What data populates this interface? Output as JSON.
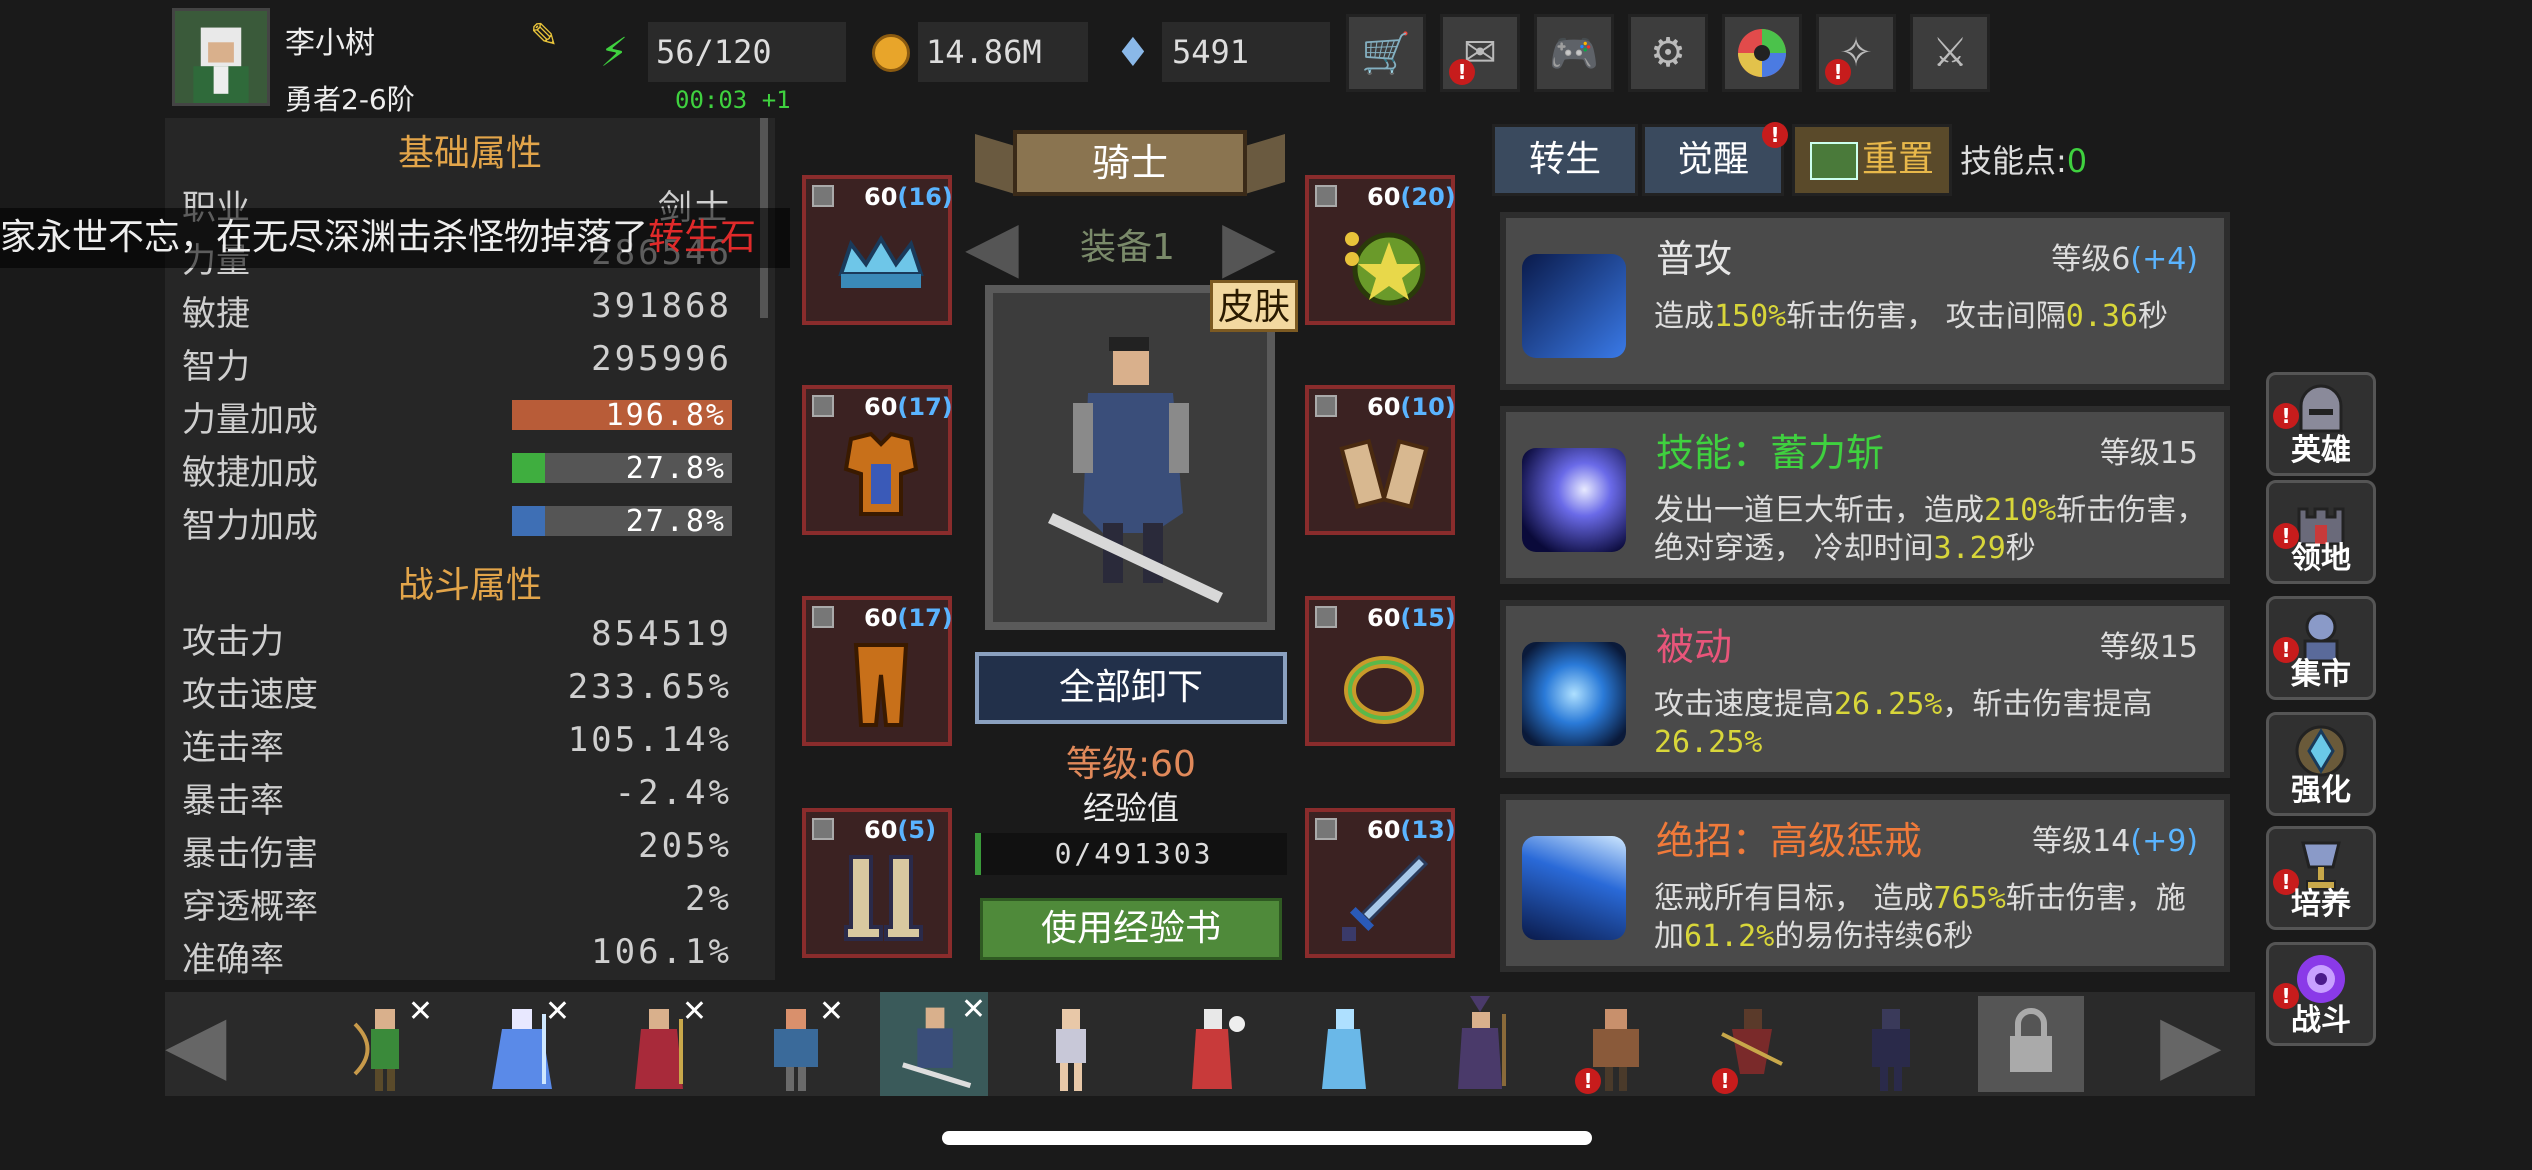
{
  "player": {
    "name": "李小树",
    "rank": "勇者2-6阶",
    "timer": "00:03 +1"
  },
  "resources": {
    "stamina": "56/120",
    "gold": "14.86M",
    "gems": "5491"
  },
  "top_buttons": [
    "cart-icon",
    "mail-icon",
    "gamepad-icon",
    "gear-icon",
    "aperture-icon",
    "crystal-icon",
    "crossed-swords-icon"
  ],
  "basic_attrs": {
    "title": "基础属性",
    "rows": [
      {
        "label": "职业",
        "value": "剑士"
      },
      {
        "label": "力量",
        "value": "286546"
      },
      {
        "label": "敏捷",
        "value": "391868"
      },
      {
        "label": "智力",
        "value": "295996"
      }
    ],
    "bonuses": [
      {
        "label": "力量加成",
        "value": "196.8%",
        "color": "#b85c38",
        "fill": 1.0
      },
      {
        "label": "敏捷加成",
        "value": "27.8%",
        "color": "#3fae3f",
        "fill": 0.15
      },
      {
        "label": "智力加成",
        "value": "27.8%",
        "color": "#3e6fb5",
        "fill": 0.15
      }
    ]
  },
  "combat_attrs": {
    "title": "战斗属性",
    "rows": [
      {
        "label": "攻击力",
        "value": "854519"
      },
      {
        "label": "攻击速度",
        "value": "233.65%"
      },
      {
        "label": "连击率",
        "value": "105.14%"
      },
      {
        "label": "暴击率",
        "value": "-2.4%"
      },
      {
        "label": "暴击伤害",
        "value": "205%"
      },
      {
        "label": "穿透概率",
        "value": "2%"
      },
      {
        "label": "准确率",
        "value": "106.1%"
      }
    ]
  },
  "ticker": {
    "text": "家永世不忘，在无尽深渊击杀怪物掉落了",
    "item": "转生石"
  },
  "equipment": {
    "class_name": "骑士",
    "set_label": "装备1",
    "skin_label": "皮肤",
    "unequip_all": "全部卸下",
    "level": "等级:60",
    "exp_label": "经验值",
    "exp_value": "0/491303",
    "use_book": "使用经验书",
    "slots": [
      {
        "lvl": "60",
        "plus": "(16)"
      },
      {
        "lvl": "60",
        "plus": "(20)"
      },
      {
        "lvl": "60",
        "plus": "(17)"
      },
      {
        "lvl": "60",
        "plus": "(10)"
      },
      {
        "lvl": "60",
        "plus": "(17)"
      },
      {
        "lvl": "60",
        "plus": "(15)"
      },
      {
        "lvl": "60",
        "plus": "(5)"
      },
      {
        "lvl": "60",
        "plus": "(13)"
      }
    ]
  },
  "skills_panel": {
    "tabs": [
      "转生",
      "觉醒",
      "重置"
    ],
    "skill_points_label": "技能点:",
    "skill_points": "0",
    "skills": [
      {
        "name": "普攻",
        "name_color": "#e6e6e6",
        "level": "等级6",
        "plus": "(+4)",
        "d1": "造成",
        "h1": "150%",
        "d2": "斩击伤害， 攻击间隔",
        "h2": "0.36",
        "d3": "秒"
      },
      {
        "name": "技能：蓄力斩",
        "name_color": "#3fd13f",
        "level": "等级15",
        "plus": "",
        "d1": "发出一道巨大斩击，造成",
        "h1": "210%",
        "d2": "斩击伤害，绝对穿透， 冷却时间",
        "h2": "3.29",
        "d3": "秒"
      },
      {
        "name": "被动",
        "name_color": "#e8557a",
        "level": "等级15",
        "plus": "",
        "d1": "攻击速度提高",
        "h1": "26.25%",
        "d2": "，斩击伤害提高",
        "h2": "26.25%",
        "d3": ""
      },
      {
        "name": "绝招：高级惩戒",
        "name_color": "#f07a3a",
        "level": "等级14",
        "plus": "(+9)",
        "d1": "惩戒所有目标， 造成",
        "h1": "765%",
        "d2": "斩击伤害，施加",
        "h2": "61.2%",
        "d3": "的易伤持续6秒"
      }
    ]
  },
  "side_nav": [
    "英雄",
    "领地",
    "集市",
    "强化",
    "培养",
    "战斗"
  ]
}
